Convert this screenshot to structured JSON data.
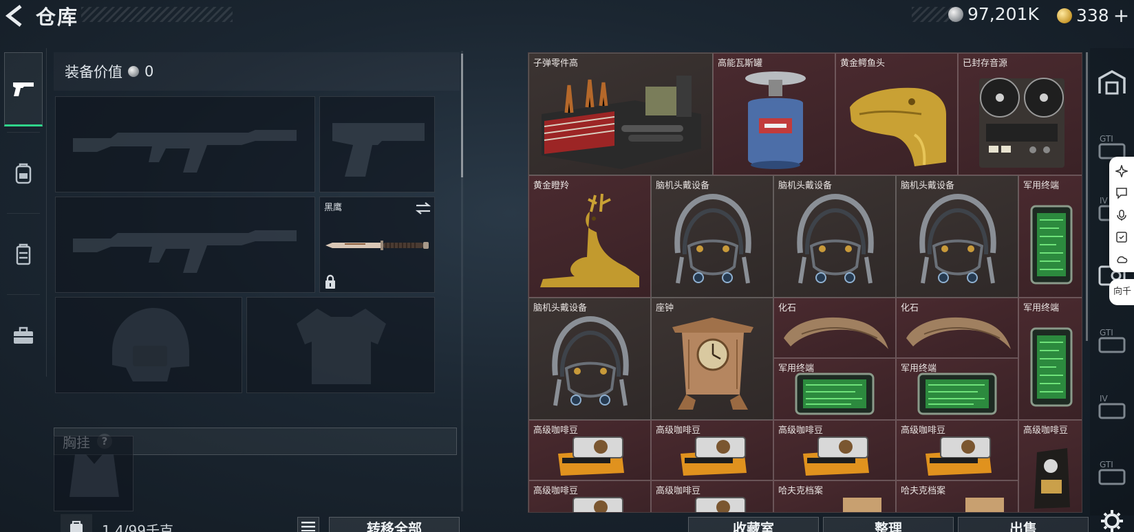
{
  "header": {
    "title": "仓库",
    "currency_silver": "97,201K",
    "currency_gold": "338",
    "add_label": "+"
  },
  "left_tabs": [
    {
      "icon": "pistol-icon",
      "active": true
    },
    {
      "icon": "backpack-icon",
      "active": false
    },
    {
      "icon": "vest-icon",
      "active": false
    },
    {
      "icon": "toolbox-icon",
      "active": false
    }
  ],
  "equipment": {
    "value_label": "装备价值",
    "value": "0",
    "melee_label": "黑鹰",
    "chest_label": "胸挂",
    "help_label": "?",
    "capacity": "1.4/99千克",
    "transfer_all_label": "转移全部"
  },
  "stash_items": [
    {
      "name": "子弹零件高",
      "color": "brown",
      "icon": "ammo-parts-crate-icon"
    },
    {
      "name": "高能瓦斯罐",
      "color": "red",
      "icon": "gas-canister-icon"
    },
    {
      "name": "黄金鳄鱼头",
      "color": "red",
      "icon": "golden-crocodile-head-icon"
    },
    {
      "name": "已封存音源",
      "color": "red",
      "icon": "reel-to-reel-recorder-icon"
    },
    {
      "name": "黄金瞪羚",
      "color": "red",
      "icon": "golden-gazelle-icon"
    },
    {
      "name": "脑机头戴设备",
      "color": "brown",
      "icon": "brain-headset-icon"
    },
    {
      "name": "脑机头戴设备",
      "color": "brown",
      "icon": "brain-headset-icon"
    },
    {
      "name": "脑机头戴设备",
      "color": "brown",
      "icon": "brain-headset-icon"
    },
    {
      "name": "军用终端",
      "color": "red",
      "icon": "military-terminal-icon"
    },
    {
      "name": "脑机头戴设备",
      "color": "brown",
      "icon": "brain-headset-icon"
    },
    {
      "name": "座钟",
      "color": "brown",
      "icon": "mantel-clock-icon"
    },
    {
      "name": "化石",
      "color": "red",
      "icon": "fossil-claw-icon"
    },
    {
      "name": "化石",
      "color": "red",
      "icon": "fossil-claw-icon"
    },
    {
      "name": "军用终端",
      "color": "red",
      "icon": "military-terminal-icon"
    },
    {
      "name": "军用终端",
      "color": "red",
      "icon": "military-terminal-icon"
    },
    {
      "name": "军用终端",
      "color": "red",
      "icon": "military-terminal-icon"
    },
    {
      "name": "高级咖啡豆",
      "color": "red",
      "icon": "coffee-beans-icon"
    },
    {
      "name": "高级咖啡豆",
      "color": "red",
      "icon": "coffee-beans-icon"
    },
    {
      "name": "高级咖啡豆",
      "color": "red",
      "icon": "coffee-beans-icon"
    },
    {
      "name": "高级咖啡豆",
      "color": "red",
      "icon": "coffee-beans-icon"
    },
    {
      "name": "高级咖啡豆",
      "color": "red",
      "icon": "coffee-bag-icon"
    },
    {
      "name": "高级咖啡豆",
      "color": "red",
      "icon": "coffee-beans-icon"
    },
    {
      "name": "高级咖啡豆",
      "color": "red",
      "icon": "coffee-beans-icon"
    },
    {
      "name": "哈夫克档案",
      "color": "red",
      "icon": "haavk-file-icon"
    },
    {
      "name": "哈夫克档案",
      "color": "red",
      "icon": "haavk-file-icon"
    }
  ],
  "bottom_buttons": {
    "collection": "收藏室",
    "sort": "整理",
    "sell": "出售"
  },
  "floating_tag": "向千",
  "colors": {
    "accent_green": "#2fd48a",
    "cell_red": "#4a2a2f",
    "cell_brown": "#3c3432"
  }
}
